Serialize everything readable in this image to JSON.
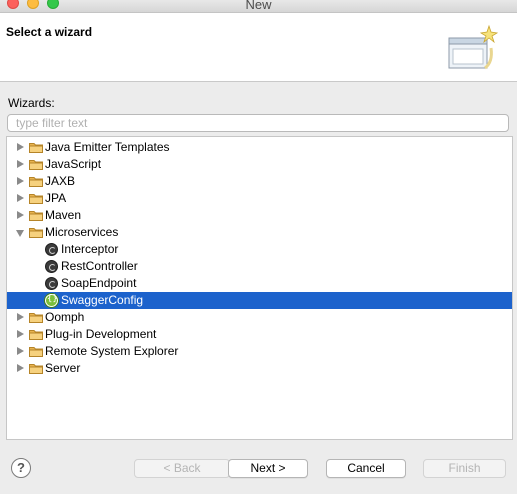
{
  "window": {
    "title": "New"
  },
  "banner": {
    "title": "Select a wizard"
  },
  "wizards_label": "Wizards:",
  "filter": {
    "placeholder": "type filter text",
    "value": ""
  },
  "tree": [
    {
      "label": "Java Emitter Templates",
      "type": "folder",
      "expanded": false,
      "level": 0
    },
    {
      "label": "JavaScript",
      "type": "folder",
      "expanded": false,
      "level": 0
    },
    {
      "label": "JAXB",
      "type": "folder",
      "expanded": false,
      "level": 0
    },
    {
      "label": "JPA",
      "type": "folder",
      "expanded": false,
      "level": 0
    },
    {
      "label": "Maven",
      "type": "folder",
      "expanded": false,
      "level": 0
    },
    {
      "label": "Microservices",
      "type": "folder",
      "expanded": true,
      "level": 0
    },
    {
      "label": "Interceptor",
      "type": "item",
      "icon": "dark-circle-icon",
      "level": 1
    },
    {
      "label": "RestController",
      "type": "item",
      "icon": "dark-circle-icon",
      "level": 1
    },
    {
      "label": "SoapEndpoint",
      "type": "item",
      "icon": "dark-circle-icon",
      "level": 1
    },
    {
      "label": "SwaggerConfig",
      "type": "item",
      "icon": "swagger-icon",
      "level": 1,
      "selected": true
    },
    {
      "label": "Oomph",
      "type": "folder",
      "expanded": false,
      "level": 0
    },
    {
      "label": "Plug-in Development",
      "type": "folder",
      "expanded": false,
      "level": 0
    },
    {
      "label": "Remote System Explorer",
      "type": "folder",
      "expanded": false,
      "level": 0
    },
    {
      "label": "Server",
      "type": "folder",
      "expanded": false,
      "level": 0
    }
  ],
  "buttons": {
    "help": "?",
    "back": "< Back",
    "next": "Next >",
    "cancel": "Cancel",
    "finish": "Finish"
  },
  "colors": {
    "selection": "#1c62cc",
    "folder": "#f2c46a"
  }
}
